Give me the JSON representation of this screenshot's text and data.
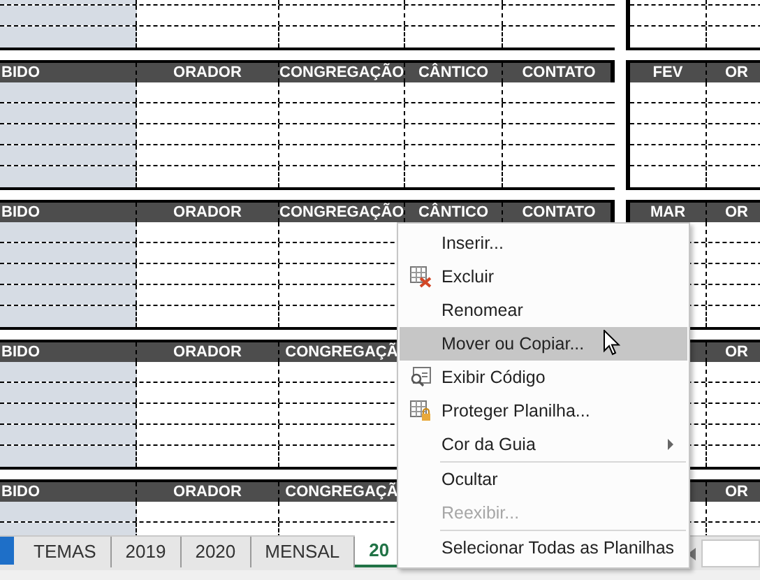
{
  "sheet": {
    "blocks": [
      {
        "headers": [
          "BIDO",
          "ORADOR",
          "CONGREGAÇÃO",
          "CÂNTICO",
          "CONTATO"
        ],
        "right_headers": [
          "FEV",
          "OR"
        ]
      },
      {
        "headers": [
          "BIDO",
          "ORADOR",
          "CONGREGAÇÃO",
          "CÂNTICO",
          "CONTATO"
        ],
        "right_headers": [
          "MAR",
          "OR"
        ]
      },
      {
        "headers": [
          "BIDO",
          "ORADOR",
          "CONGREGAÇÃ"
        ],
        "right_headers": [
          "OR"
        ]
      },
      {
        "headers": [
          "BIDO",
          "ORADOR",
          "CONGREGAÇÃ"
        ],
        "right_headers": [
          "OR"
        ]
      }
    ]
  },
  "sheet_tabs": [
    {
      "label": "TEMAS",
      "selected": false
    },
    {
      "label": "2019",
      "selected": false
    },
    {
      "label": "2020",
      "selected": false
    },
    {
      "label": "MENSAL",
      "selected": false
    },
    {
      "label": "20",
      "selected": true
    }
  ],
  "context_menu": [
    {
      "kind": "item",
      "label": "Inserir...",
      "selected": false,
      "disabled": false,
      "submenu": false
    },
    {
      "kind": "item",
      "label": "Excluir",
      "selected": false,
      "disabled": false,
      "submenu": false
    },
    {
      "kind": "item",
      "label": "Renomear",
      "selected": false,
      "disabled": false,
      "submenu": false
    },
    {
      "kind": "item",
      "label": "Mover ou Copiar...",
      "selected": true,
      "disabled": false,
      "submenu": false
    },
    {
      "kind": "item",
      "label": "Exibir Código",
      "selected": false,
      "disabled": false,
      "submenu": false
    },
    {
      "kind": "item",
      "label": "Proteger Planilha...",
      "selected": false,
      "disabled": false,
      "submenu": false
    },
    {
      "kind": "item",
      "label": "Cor da Guia",
      "selected": false,
      "disabled": false,
      "submenu": true
    },
    {
      "kind": "separator"
    },
    {
      "kind": "item",
      "label": "Ocultar",
      "selected": false,
      "disabled": false,
      "submenu": false
    },
    {
      "kind": "item",
      "label": "Reexibir...",
      "selected": false,
      "disabled": true,
      "submenu": false
    },
    {
      "kind": "separator"
    },
    {
      "kind": "item",
      "label": "Selecionar Todas as Planilhas",
      "selected": false,
      "disabled": false,
      "submenu": false
    }
  ]
}
